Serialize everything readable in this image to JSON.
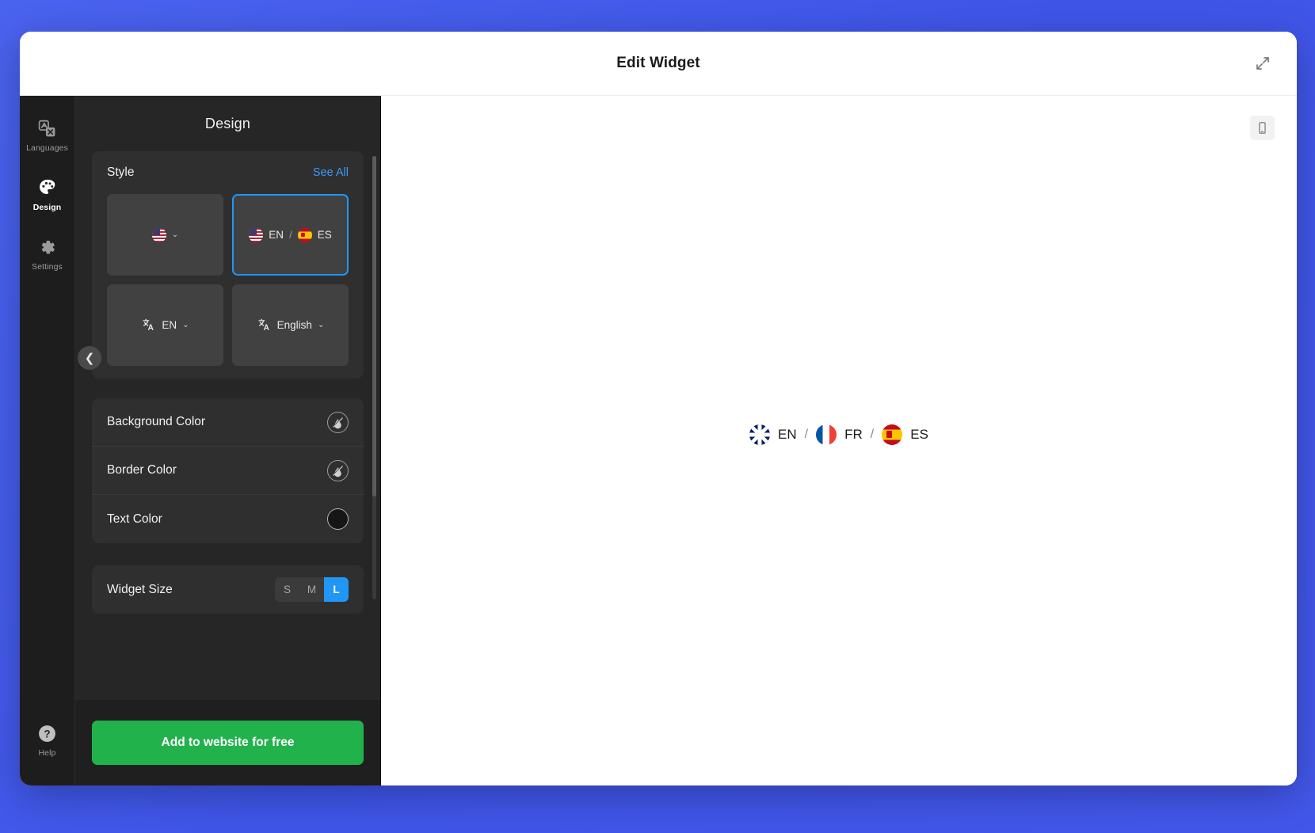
{
  "header": {
    "title": "Edit Widget",
    "expand_icon": "expand-diagonal-icon"
  },
  "rail": {
    "items": [
      {
        "label": "Languages",
        "icon": "translate-languages-icon",
        "active": false
      },
      {
        "label": "Design",
        "icon": "palette-icon",
        "active": true
      },
      {
        "label": "Settings",
        "icon": "gear-icon",
        "active": false
      }
    ],
    "help": {
      "label": "Help",
      "icon": "question-circle-icon"
    }
  },
  "panel": {
    "title": "Design",
    "style_section": {
      "label": "Style",
      "see_all_label": "See All",
      "prev_icon": "chevron-left-icon",
      "next_icon": "chevron-right-icon",
      "cards": [
        {
          "id": "flag-dropdown",
          "kind": "flag-dropdown",
          "flags": [
            "us"
          ],
          "text": "",
          "chevron": "⌄",
          "selected": false
        },
        {
          "id": "flag-pair",
          "kind": "flag-pair",
          "flags": [
            "us",
            "es"
          ],
          "labels": [
            "EN",
            "ES"
          ],
          "separator": "/",
          "selected": true
        },
        {
          "id": "translate-code",
          "kind": "translate-dropdown",
          "icon": "translate-icon",
          "text": "EN",
          "chevron": "⌄",
          "selected": false
        },
        {
          "id": "translate-name",
          "kind": "translate-dropdown",
          "icon": "translate-icon",
          "text": "English",
          "chevron": "⌄",
          "selected": false
        }
      ]
    },
    "color_rows": [
      {
        "label": "Background Color",
        "swatch": "none",
        "swatch_icon": "no-color-slash-icon"
      },
      {
        "label": "Border Color",
        "swatch": "none",
        "swatch_icon": "no-color-slash-icon"
      },
      {
        "label": "Text Color",
        "swatch": "#161616",
        "swatch_icon": "color-circle-icon"
      }
    ],
    "widget_size": {
      "label": "Widget Size",
      "options": [
        "S",
        "M",
        "L"
      ],
      "selected": "L"
    },
    "cta_label": "Add to website for free"
  },
  "preview": {
    "device_toggle_icon": "mobile-device-icon",
    "widget": {
      "separator": "/",
      "languages": [
        {
          "code": "EN",
          "flag": "gb"
        },
        {
          "code": "FR",
          "flag": "fr"
        },
        {
          "code": "ES",
          "flag": "es"
        }
      ]
    }
  },
  "colors": {
    "accent": "#2196f3",
    "cta_green": "#22b24c",
    "link_blue": "#3b9bf5",
    "panel_bg": "#262626",
    "page_bg": "#4361ee"
  }
}
